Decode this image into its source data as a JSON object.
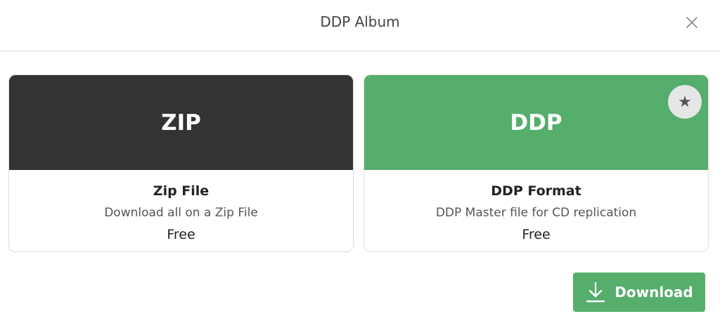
{
  "dialog": {
    "title": "DDP Album",
    "close_icon": "close-icon"
  },
  "options": [
    {
      "banner": "ZIP",
      "banner_color": "#333333",
      "name": "Zip File",
      "description": "Download all on a Zip File",
      "price": "Free"
    },
    {
      "banner": "DDP",
      "banner_color": "#55ae6c",
      "name": "DDP Format",
      "description": "DDP Master file for CD replication",
      "price": "Free",
      "badge_icon": "star-icon",
      "badge_glyph": "★"
    }
  ],
  "download": {
    "label": "Download",
    "icon": "download-icon",
    "color": "#55ae6c"
  }
}
